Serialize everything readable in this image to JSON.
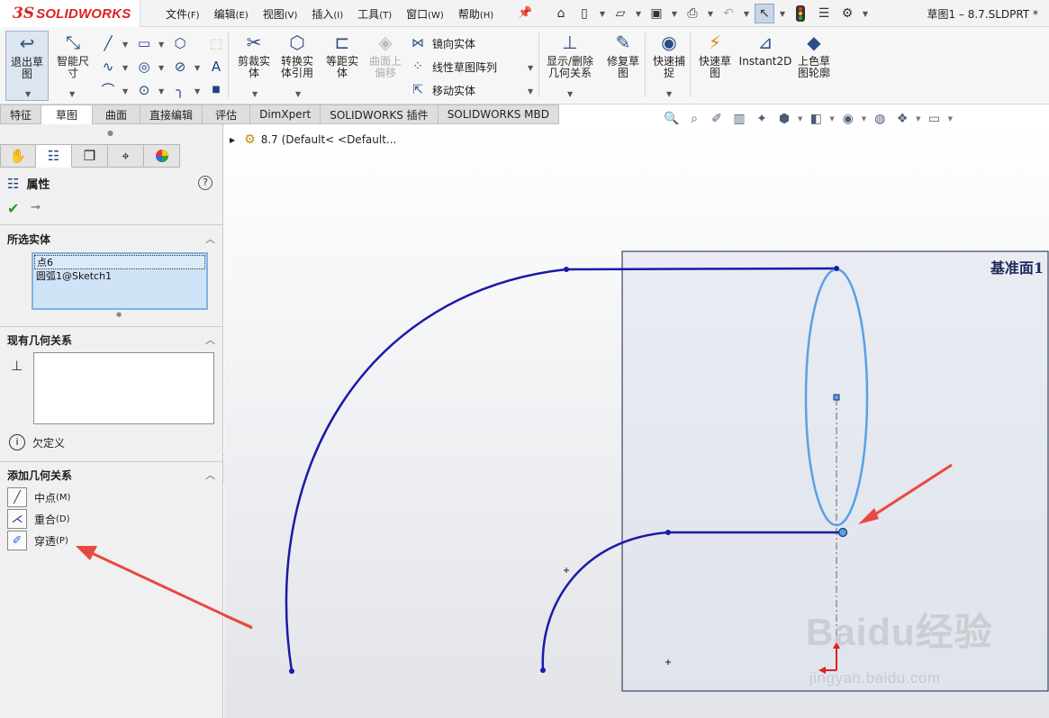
{
  "app": {
    "logo_prefix": "3S",
    "logo_name": "SOLIDWORKS",
    "document_title": "草图1 – 8.7.SLDPRT *"
  },
  "menu": [
    {
      "label": "文件",
      "accel": "(F)"
    },
    {
      "label": "编辑",
      "accel": "(E)"
    },
    {
      "label": "视图",
      "accel": "(V)"
    },
    {
      "label": "插入",
      "accel": "(I)"
    },
    {
      "label": "工具",
      "accel": "(T)"
    },
    {
      "label": "窗口",
      "accel": "(W)"
    },
    {
      "label": "帮助",
      "accel": "(H)"
    }
  ],
  "quick_access": [
    "home-icon",
    "new-document-icon",
    "open-icon",
    "save-icon",
    "print-icon",
    "undo-icon",
    "select-pointer-icon",
    "rebuild-icon",
    "file-properties-icon",
    "options-gear-icon"
  ],
  "commands": {
    "exit_sketch": "退出草图",
    "smart_dimension": "智能尺寸",
    "trim_entities": "剪裁实体",
    "convert_entities": "转换实体引用",
    "offset_entities": "等距实体",
    "offset_on_surface": "曲面上偏移",
    "mirror_entities": "镜向实体",
    "linear_pattern": "线性草图阵列",
    "move_entities": "移动实体",
    "display_delete_relations": "显示/删除几何关系",
    "repair_sketch": "修复草图",
    "quick_snaps": "快速捕捉",
    "rapid_sketch": "快速草图",
    "instant2d": "Instant2D",
    "shaded_sketch_contours": "上色草图轮廓"
  },
  "tabs": [
    {
      "label": "特征",
      "active": false
    },
    {
      "label": "草图",
      "active": true
    },
    {
      "label": "曲面",
      "active": false
    },
    {
      "label": "直接编辑",
      "active": false
    },
    {
      "label": "评估",
      "active": false
    },
    {
      "label": "DimXpert",
      "active": false
    },
    {
      "label": "SOLIDWORKS 插件",
      "active": false
    },
    {
      "label": "SOLIDWORKS MBD",
      "active": false
    }
  ],
  "property_manager": {
    "title": "属性",
    "selected_entities_header": "所选实体",
    "selected_entities": [
      "点6",
      "圆弧1@Sketch1"
    ],
    "existing_relations_header": "现有几何关系",
    "status": "欠定义",
    "add_relations_header": "添加几何关系",
    "add_relations": [
      {
        "label": "中点",
        "accel": "(M)",
        "icon": "midpoint-icon"
      },
      {
        "label": "重合",
        "accel": "(D)",
        "icon": "coincident-icon"
      },
      {
        "label": "穿透",
        "accel": "(P)",
        "icon": "pierce-icon"
      }
    ]
  },
  "graphics": {
    "tree_flyout_label": "8.7  (Default< <Default...",
    "plane_label": "基准面1",
    "watermark": "Baidu经验",
    "watermark_url": "jingyan.baidu.com",
    "colors": {
      "sketch_line": "#1a1aa8",
      "ellipse_selected": "#5aa0e6",
      "arrow": "#e8493f",
      "plane_fill": "#dde1ec",
      "plane_border": "#3e4660"
    }
  }
}
